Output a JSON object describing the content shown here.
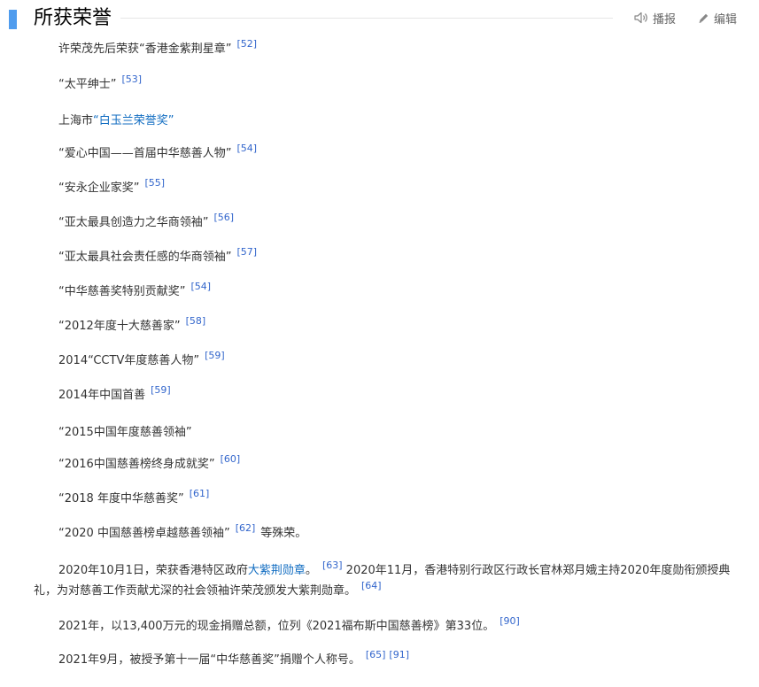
{
  "section": {
    "title": "所获荣誉",
    "actions": {
      "listen_label": "播报",
      "edit_label": "编辑"
    }
  },
  "items": [
    {
      "text": "许荣茂先后荣获“香港金紫荆星章”",
      "refs": [
        "[52]"
      ]
    },
    {
      "text": "“太平绅士”",
      "refs": [
        "[53]"
      ]
    },
    {
      "pre": "上海市",
      "link": "“白玉兰荣誉奖”"
    },
    {
      "text": "“爱心中国——首届中华慈善人物”",
      "refs": [
        "[54]"
      ]
    },
    {
      "text": "“安永企业家奖”",
      "refs": [
        "[55]"
      ]
    },
    {
      "text": "“亚太最具创造力之华商领袖”",
      "refs": [
        "[56]"
      ]
    },
    {
      "text": "“亚太最具社会责任感的华商领袖”",
      "refs": [
        "[57]"
      ]
    },
    {
      "text": "“中华慈善奖特别贡献奖”",
      "refs": [
        "[54]"
      ]
    },
    {
      "text": "“2012年度十大慈善家”",
      "refs": [
        "[58]"
      ]
    },
    {
      "text": "2014“CCTV年度慈善人物”",
      "refs": [
        "[59]"
      ]
    },
    {
      "text": "2014年中国首善",
      "refs": [
        "[59]"
      ]
    },
    {
      "text": "“2015中国年度慈善领袖”"
    },
    {
      "text": "“2016中国慈善榜终身成就奖”",
      "refs": [
        "[60]"
      ]
    },
    {
      "text": "“2018 年度中华慈善奖”",
      "refs": [
        "[61]"
      ]
    },
    {
      "text": "“2020 中国慈善榜卓越慈善领袖”",
      "refs": [
        "[62]"
      ],
      "post": "等殊荣。"
    }
  ],
  "paragraphs": {
    "p2020": {
      "a": "2020年10月1日，荣获香港特区政府",
      "link": "大紫荆勋章",
      "b": "。",
      "ref1": "[63]",
      "c": "2020年11月，香港特别行政区行政长官林郑月娥主持2020年度勋衔颁授典礼，为对慈善工作贡献尤深的社会领袖许荣茂颁发大紫荆勋章。",
      "ref2": "[64]"
    },
    "p2021a": {
      "text": "2021年，以13,400万元的现金捐赠总额，位列《2021福布斯中国慈善榜》第33位。",
      "ref": "[90]"
    },
    "p2021b": {
      "text": "2021年9月，被授予第十一届“中华慈善奖”捐赠个人称号。",
      "ref1": "[65]",
      "ref2": "[91]"
    }
  },
  "icons": {
    "listen": "speaker-icon",
    "edit": "pencil-icon"
  },
  "colors": {
    "accent": "#4f9cee",
    "link": "#136ec2",
    "ref": "#3366cc",
    "text": "#333333"
  }
}
